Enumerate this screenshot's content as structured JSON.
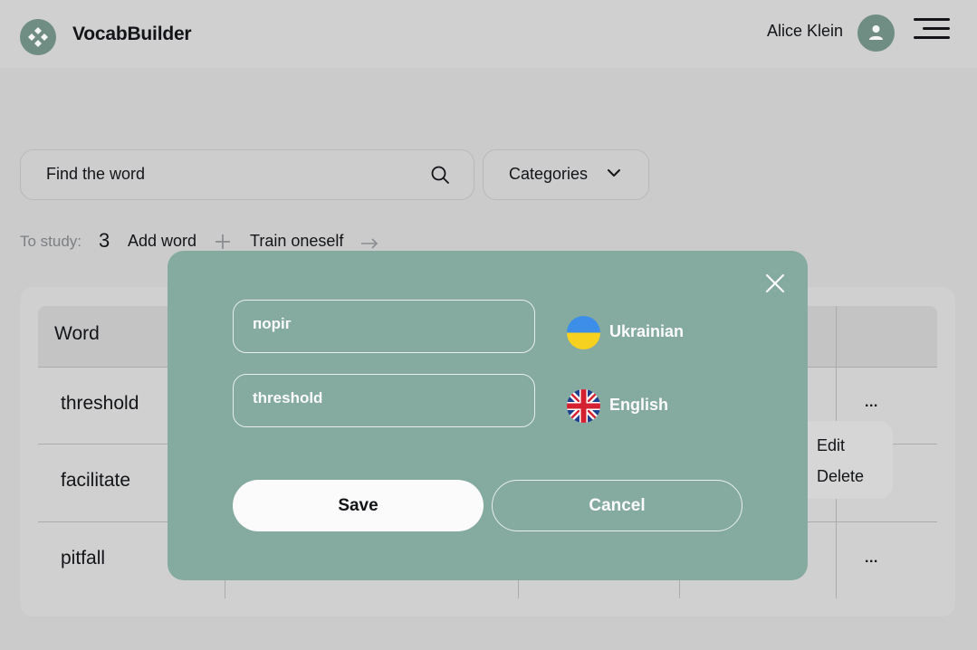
{
  "header": {
    "app_title": "VocabBuilder",
    "user_name": "Alice Klein"
  },
  "search": {
    "placeholder": "Find the word"
  },
  "filter": {
    "categories_label": "Categories"
  },
  "toolbar": {
    "to_study_label": "To study:",
    "to_study_count": "3",
    "add_word_label": "Add word",
    "train_label": "Train oneself"
  },
  "table": {
    "column_word": "Word",
    "rows": [
      {
        "word": "threshold",
        "actions": "..."
      },
      {
        "word": "facilitate",
        "actions": ""
      },
      {
        "word": "pitfall",
        "actions": "..."
      }
    ]
  },
  "context_menu": {
    "edit_label": "Edit",
    "delete_label": "Delete"
  },
  "modal": {
    "ukrainian_value": "поріг",
    "ukrainian_label": "Ukrainian",
    "english_value": "threshold",
    "english_label": "English",
    "save_label": "Save",
    "cancel_label": "Cancel"
  },
  "colors": {
    "accent": "#85aa9f",
    "brand_dark": "#6f8d83",
    "text": "#121417",
    "white": "#fbfbfb"
  },
  "icons": [
    "logo-icon",
    "user-icon",
    "menu-icon",
    "search-icon",
    "chevron-down-icon",
    "plus-icon",
    "arrow-right-icon",
    "close-icon",
    "ukraine-flag-icon",
    "uk-flag-icon"
  ]
}
